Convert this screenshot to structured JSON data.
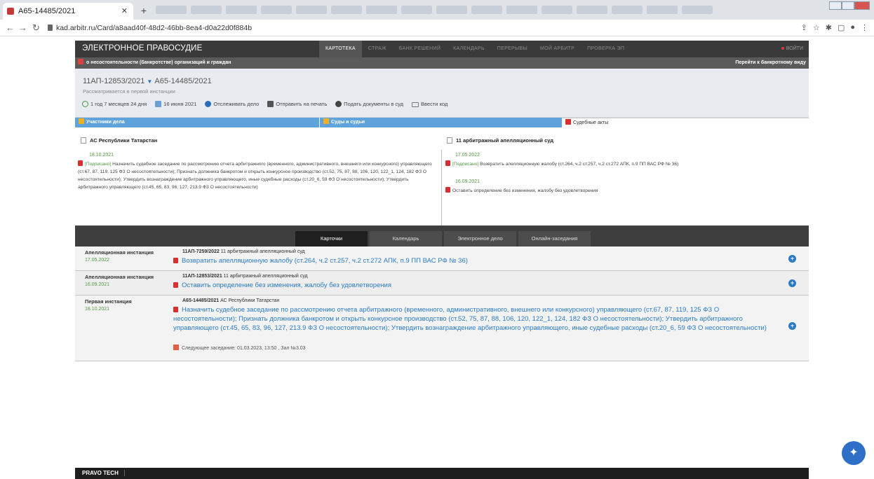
{
  "browser": {
    "tab_title": "А65-14485/2021",
    "url": "kad.arbitr.ru/Card/a8aad40f-48d2-46bb-8ea4-d0a22d0f884b"
  },
  "topbar": {
    "logo": "ЭЛЕКТРОННОЕ ПРАВОСУДИЕ",
    "menu": [
      "КАРТОТЕКА",
      "СТРАЖ",
      "БАНК РЕШЕНИЙ",
      "КАЛЕНДАРЬ",
      "ПЕРЕРЫВЫ",
      "МОЙ АРБИТР",
      "ПРОВЕРКА ЭП"
    ],
    "login": "ВОЙТИ"
  },
  "category": {
    "label": "о несостоятельности (банкротстве) организаций и граждан",
    "switch_view": "Перейти к банкротному виду"
  },
  "case": {
    "num1": "11АП-12853/2021",
    "num2": "А65-14485/2021",
    "stage": "Рассматривается в первой инстанции",
    "duration": "1 год 7 месяцев 24 дня",
    "date": "16 июня 2021",
    "track": "Отслеживать дело",
    "print": "Отправить на печать",
    "submit": "Подать документы в суд",
    "code": "Ввести код"
  },
  "tabs": {
    "participants": "Участники дела",
    "courts": "Суды и судьи",
    "acts": "Судебные акты"
  },
  "acts": {
    "left": {
      "court": "АС Республики Татарстан",
      "date": "18.10.2021",
      "signed": "[Подписано]",
      "text": " Назначить судебное заседание по рассмотрению отчета арбитражного (временного, административного, внешнего или конкурсного) управляющего (ст.67, 87, 119, 125 ФЗ О несостоятельности); Признать должника банкротом и открыть конкурсное производство (ст.52, 75, 87, 88, 106, 120, 122_1, 124, 182 ФЗ О несостоятельности); Утвердить вознаграждение арбитражного управляющего, иные судебные расходы (ст.20_6, 59 ФЗ О несостоятельности); Утвердить арбитражного управляющего (ст.45, 65, 83, 96, 127, 213.9 ФЗ О несостоятельности)"
    },
    "right": {
      "court": "11 арбитражный апелляционный суд",
      "date1": "17.05.2022",
      "signed": "[Подписано]",
      "text1": " Возвратить апелляционную жалобу (ст.264, ч.2 ст.257, ч.2 ст.272 АПК, п.9 ПП ВАС РФ № 36)",
      "date2": "16.09.2021",
      "text2": "Оставить определение без изменения, жалобу без удовлетворения"
    }
  },
  "view_tabs": [
    "Карточки",
    "Календарь",
    "Электронное дело",
    "Онлайн-заседания"
  ],
  "rows": [
    {
      "instance": "Апелляционная инстанция",
      "date": "17.05.2022",
      "case_num": "11АП-7259/2022",
      "court": " 11 арбитражный апелляционный суд",
      "text": "Возвратить апелляционную жалобу (ст.264, ч.2 ст.257, ч.2 ст.272 АПК, п.9 ПП ВАС РФ № 36)"
    },
    {
      "instance": "Апелляционная инстанция",
      "date": "16.09.2021",
      "case_num": "11АП-12853/2021",
      "court": " 11 арбитражный апелляционный суд",
      "text": "Оставить определение без изменения, жалобу без удовлетворения"
    },
    {
      "instance": "Первая инстанция",
      "date": "18.10.2021",
      "case_num": "А65-14485/2021",
      "court": " АС Республики Татарстан",
      "text": "Назначить судебное заседание по рассмотрению отчета арбитражного (временного, административного, внешнего или конкурсного) управляющего (ст.67, 87, 119, 125 ФЗ О несостоятельности); Признать должника банкротом и открыть конкурсное производство (ст.52, 75, 87, 88, 106, 120, 122_1, 124, 182 ФЗ О несостоятельности); Утвердить арбитражного управляющего (ст.45, 65, 83, 96, 127, 213.9 ФЗ О несостоятельности); Утвердить вознаграждение арбитражного управляющего, иные судебные расходы (ст.20_6, 59 ФЗ О несостоятельности)",
      "next": "Следующее заседание: 01.03.2023, 13:50 , Зал №3.03"
    }
  ],
  "footer": "PRAVO TECH"
}
